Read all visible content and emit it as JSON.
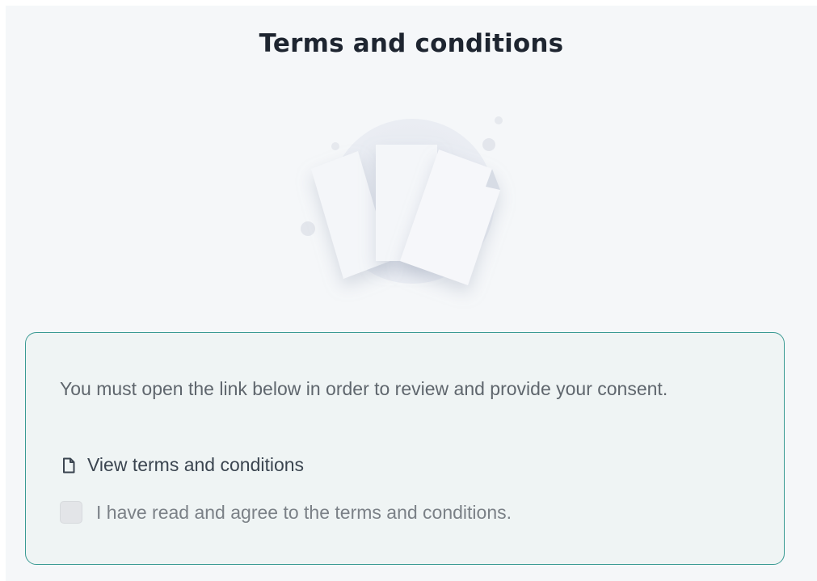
{
  "header": {
    "title": "Terms and conditions"
  },
  "illustration": {
    "icon": "documents-illustration-icon"
  },
  "consent": {
    "message": "You must open the link below in order to review and provide your consent.",
    "link_label": "View terms and conditions",
    "link_icon": "document-icon",
    "checkbox_label": "I have read and agree to the terms and conditions.",
    "checkbox_checked": false
  },
  "colors": {
    "accent_border": "#3a9a93",
    "page_background": "#f5f7f9",
    "card_background": "#eff4f4"
  }
}
